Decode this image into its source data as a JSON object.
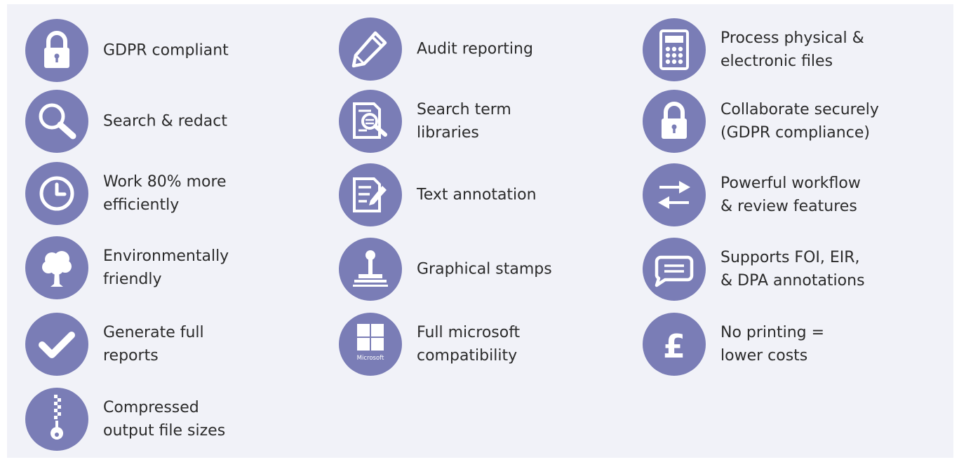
{
  "features": {
    "col1": [
      {
        "icon": "lock-icon",
        "label": "GDPR compliant"
      },
      {
        "icon": "magnifier-icon",
        "label": "Search & redact"
      },
      {
        "icon": "clock-icon",
        "label": "Work 80% more\nefficiently"
      },
      {
        "icon": "tree-icon",
        "label": "Environmentally\nfriendly"
      },
      {
        "icon": "checkmark-icon",
        "label": "Generate full\nreports"
      },
      {
        "icon": "zipper-icon",
        "label": "Compressed\noutput file sizes"
      }
    ],
    "col2": [
      {
        "icon": "pencil-icon",
        "label": "Audit reporting"
      },
      {
        "icon": "document-search-icon",
        "label": "Search term\nlibraries"
      },
      {
        "icon": "document-edit-icon",
        "label": "Text annotation"
      },
      {
        "icon": "stamp-icon",
        "label": "Graphical stamps"
      },
      {
        "icon": "microsoft-logo-icon",
        "label": "Full microsoft\ncompatibility",
        "logo_text": "Microsoft"
      }
    ],
    "col3": [
      {
        "icon": "calculator-icon",
        "label": "Process physical &\nelectronic files"
      },
      {
        "icon": "lock-icon",
        "label": "Collaborate securely\n(GDPR compliance)"
      },
      {
        "icon": "arrows-exchange-icon",
        "label": "Powerful workflow\n& review features"
      },
      {
        "icon": "speech-bubble-icon",
        "label": "Supports FOI, EIR,\n& DPA annotations"
      },
      {
        "icon": "pound-sign-icon",
        "label": "No printing =\nlower costs"
      }
    ]
  },
  "colors": {
    "panel_background": "#f1f2f8",
    "icon_circle": "#7a7db6",
    "icon_glyph": "#ffffff",
    "text": "#2b2b2b"
  }
}
